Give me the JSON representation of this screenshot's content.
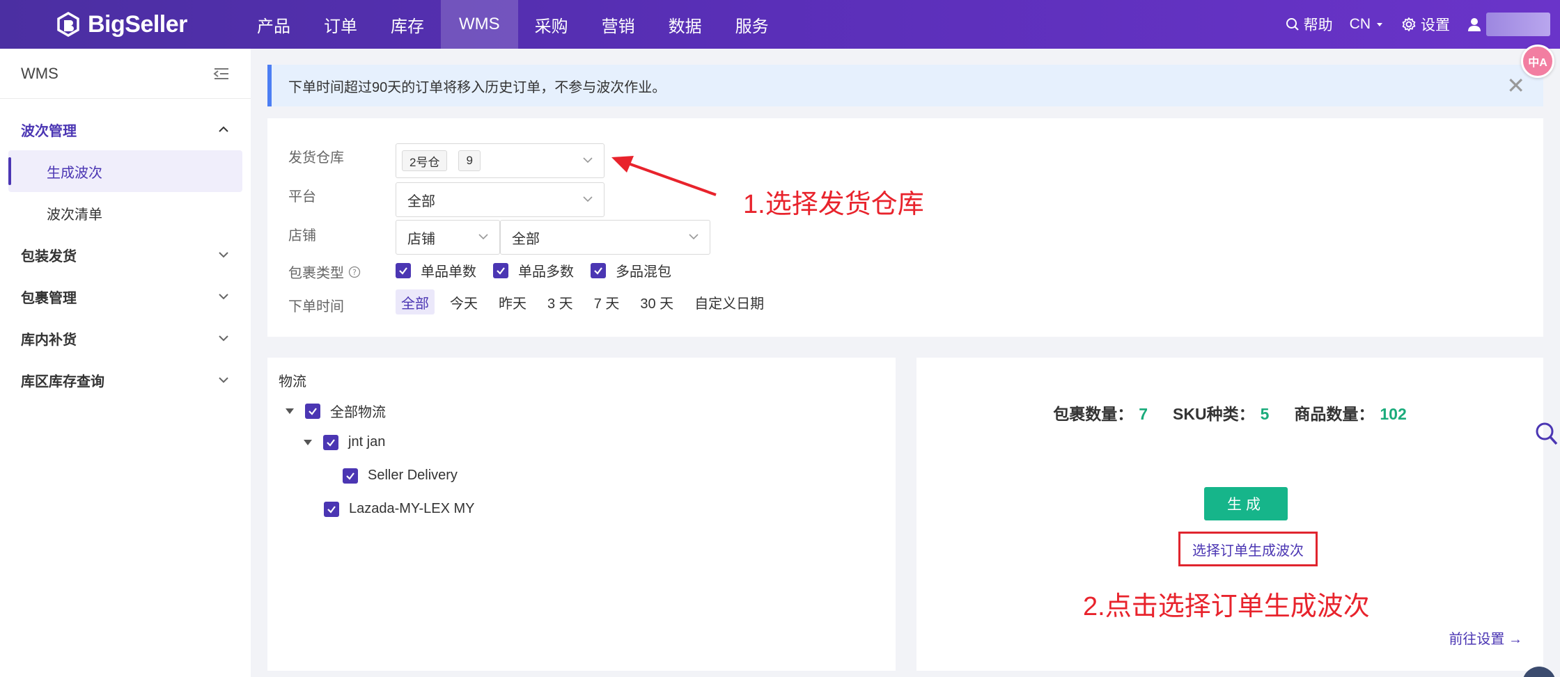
{
  "header": {
    "logo_text": "BigSeller",
    "nav": [
      "产品",
      "订单",
      "库存",
      "WMS",
      "采购",
      "营销",
      "数据",
      "服务"
    ],
    "active_nav": "WMS",
    "help_label": "帮助",
    "lang_label": "CN",
    "settings_label": "设置"
  },
  "sidebar": {
    "title": "WMS",
    "groups": [
      {
        "label": "波次管理",
        "open": true,
        "items": [
          {
            "label": "生成波次",
            "active": true
          },
          {
            "label": "波次清单",
            "active": false
          }
        ]
      },
      {
        "label": "包装发货",
        "open": false
      },
      {
        "label": "包裹管理",
        "open": false
      },
      {
        "label": "库内补货",
        "open": false
      },
      {
        "label": "库区库存查询",
        "open": false
      }
    ]
  },
  "banner": {
    "text": "下单时间超过90天的订单将移入历史订单，不参与波次作业。"
  },
  "filters": {
    "warehouse": {
      "label": "发货仓库",
      "tags": [
        "2号仓",
        "9"
      ]
    },
    "platform": {
      "label": "平台",
      "value": "全部"
    },
    "store": {
      "label": "店铺",
      "type_value": "店铺",
      "value": "全部"
    },
    "package_type": {
      "label": "包裹类型",
      "options": [
        "单品单数",
        "单品多数",
        "多品混包"
      ]
    },
    "order_time": {
      "label": "下单时间",
      "options": [
        "全部",
        "今天",
        "昨天",
        "3 天",
        "7 天",
        "30 天",
        "自定义日期"
      ],
      "selected": "全部"
    }
  },
  "logistics": {
    "title": "物流",
    "tree": [
      {
        "label": "全部物流"
      },
      {
        "label": "jnt jan"
      },
      {
        "label": "Seller Delivery"
      },
      {
        "label": "Lazada-MY-LEX MY"
      }
    ]
  },
  "summary": {
    "parcel_label": "包裹数量：",
    "parcel_value": "7",
    "sku_label": "SKU种类：",
    "sku_value": "5",
    "goods_label": "商品数量：",
    "goods_value": "102",
    "generate_label": "生成",
    "select_link": "选择订单生成波次",
    "goto_settings": "前往设置 →"
  },
  "annotations": {
    "step1": "1.选择发货仓库",
    "step2": "2.点击选择订单生成波次"
  },
  "colors": {
    "brand": "#4b36b3",
    "accent_green": "#16b58a",
    "annotation_red": "#e8232c"
  },
  "translate_fab": "中A"
}
